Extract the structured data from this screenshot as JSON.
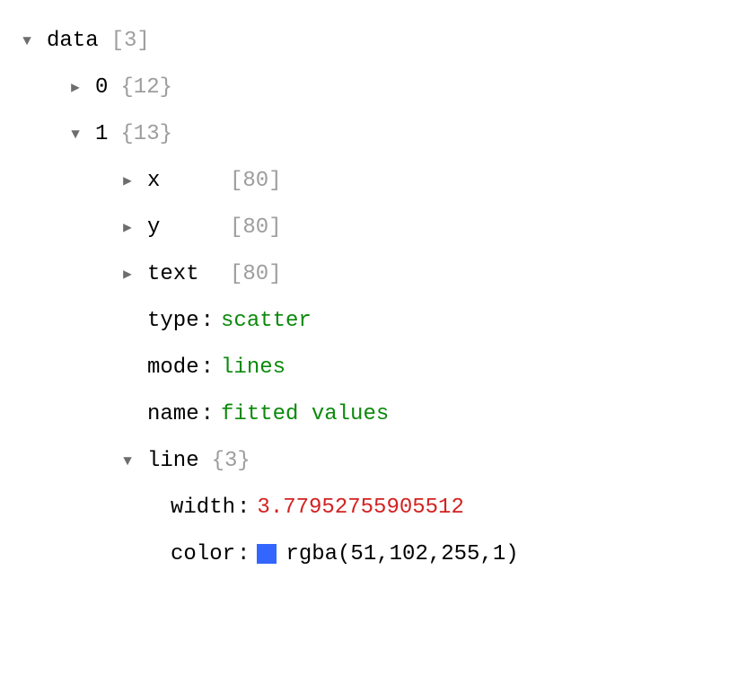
{
  "root": {
    "key": "data",
    "meta": "[3]"
  },
  "item0": {
    "key": "0",
    "meta": "{12}"
  },
  "item1": {
    "key": "1",
    "meta": "{13}"
  },
  "x": {
    "key": "x",
    "meta": "[80]"
  },
  "y": {
    "key": "y",
    "meta": "[80]"
  },
  "text": {
    "key": "text",
    "meta": "[80]"
  },
  "type": {
    "key": "type",
    "value": "scatter"
  },
  "mode": {
    "key": "mode",
    "value": "lines"
  },
  "name": {
    "key": "name",
    "value": "fitted values"
  },
  "line": {
    "key": "line",
    "meta": "{3}"
  },
  "width": {
    "key": "width",
    "value": "3.77952755905512"
  },
  "color": {
    "key": "color",
    "value": "rgba(51,102,255,1)",
    "swatch": "rgba(51,102,255,1)"
  },
  "glyphs": {
    "expanded": "▼",
    "collapsed": "▶"
  }
}
